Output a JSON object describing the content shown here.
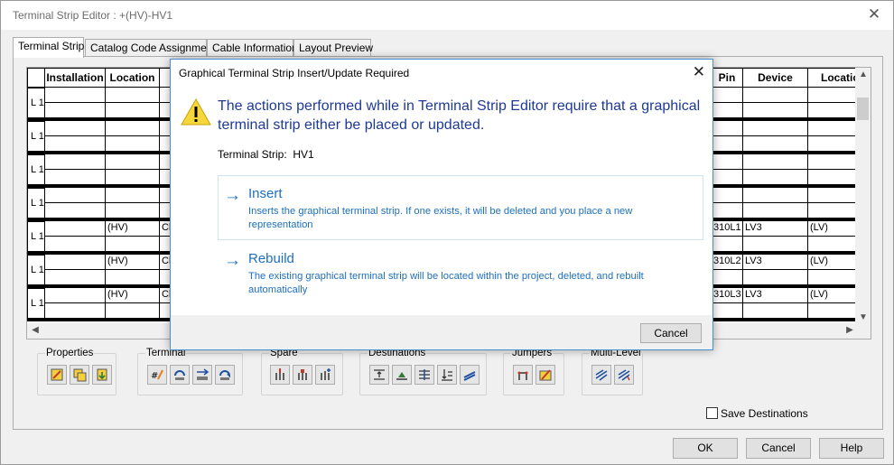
{
  "window": {
    "title": "Terminal Strip Editor : +(HV)-HV1"
  },
  "tabs": [
    {
      "label": "Terminal Strip"
    },
    {
      "label": "Catalog Code Assignment"
    },
    {
      "label": "Cable Information"
    },
    {
      "label": "Layout Preview"
    }
  ],
  "grid": {
    "left_headers": [
      "Installation",
      "Location"
    ],
    "right_headers": [
      "Pin",
      "Device",
      "Location"
    ],
    "row_label": "L 1",
    "rows": [
      {
        "installation": "",
        "location": "",
        "col3": "",
        "pin": "",
        "device": "",
        "rlocation": ""
      },
      {
        "installation": "",
        "location": "",
        "col3": "",
        "pin": "",
        "device": "",
        "rlocation": ""
      },
      {
        "installation": "",
        "location": "",
        "col3": "",
        "pin": "",
        "device": "",
        "rlocation": ""
      },
      {
        "installation": "",
        "location": "",
        "col3": "",
        "pin": "",
        "device": "",
        "rlocation": ""
      },
      {
        "installation": "",
        "location": "(HV)",
        "col3": "Cl",
        "pin": "310L1",
        "device": "LV3",
        "rlocation": "(LV)"
      },
      {
        "installation": "",
        "location": "(HV)",
        "col3": "Cl",
        "pin": "310L2",
        "device": "LV3",
        "rlocation": "(LV)"
      },
      {
        "installation": "",
        "location": "(HV)",
        "col3": "Cl",
        "pin": "310L3",
        "device": "LV3",
        "rlocation": "(LV)"
      }
    ]
  },
  "toolbar_groups": [
    {
      "label": "Properties"
    },
    {
      "label": "Terminal"
    },
    {
      "label": "Spare"
    },
    {
      "label": "Destinations"
    },
    {
      "label": "Jumpers"
    },
    {
      "label": "Multi-Level"
    }
  ],
  "save_destinations": {
    "label": "Save Destinations",
    "checked": false
  },
  "buttons": {
    "ok": "OK",
    "cancel": "Cancel",
    "help": "Help"
  },
  "dialog": {
    "title": "Graphical Terminal Strip Insert/Update Required",
    "message": "The actions performed while in Terminal Strip Editor require that a graphical terminal strip either be placed or updated.",
    "strip_label": "Terminal Strip:",
    "strip_value": "HV1",
    "options": [
      {
        "title": "Insert",
        "description": "Inserts the graphical terminal strip.  If one exists, it will be deleted and you place a new representation"
      },
      {
        "title": "Rebuild",
        "description": "The existing graphical terminal strip will be located within the project, deleted, and rebuilt automatically"
      }
    ],
    "cancel": "Cancel"
  },
  "colors": {
    "accent": "#1e6fbf",
    "message": "#1e3a96",
    "dialog_border": "#4a90d0"
  }
}
